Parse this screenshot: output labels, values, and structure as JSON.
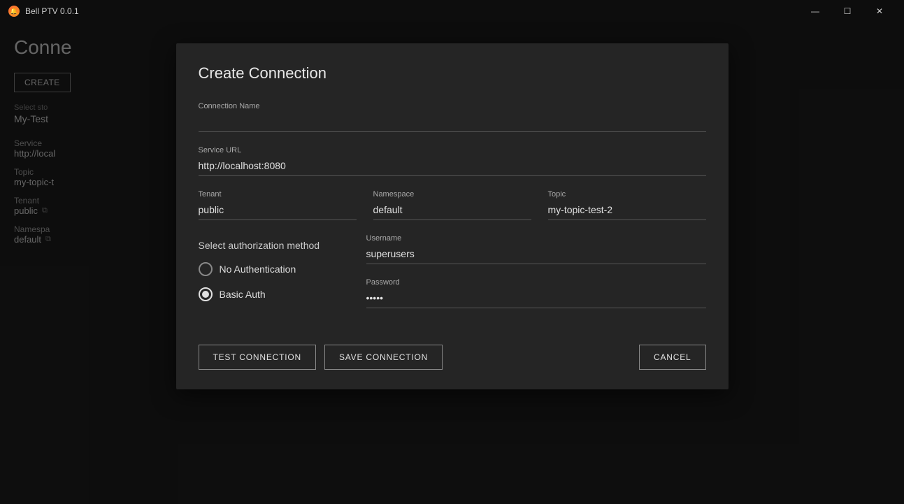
{
  "titlebar": {
    "title": "Bell PTV 0.0.1",
    "icon": "🔔",
    "minimize_label": "—",
    "maximize_label": "☐",
    "close_label": "✕"
  },
  "background": {
    "page_title": "Conne",
    "create_btn": "CREATE",
    "select_label": "Select sto",
    "select_value": "My-Test",
    "service_label": "Service",
    "service_value": "http://local",
    "topic_label": "Topic",
    "topic_value": "my-topic-t",
    "tenant_label": "Tenant",
    "tenant_value": "public",
    "namespace_label": "Namespa",
    "namespace_value": "default"
  },
  "modal": {
    "title": "Create Connection",
    "connection_name_label": "Connection Name",
    "connection_name_value": "",
    "connection_name_placeholder": "",
    "service_url_label": "Service URL",
    "service_url_value": "http://localhost:8080",
    "tenant_label": "Tenant",
    "tenant_value": "public",
    "namespace_label": "Namespace",
    "namespace_value": "default",
    "topic_label": "Topic",
    "topic_value": "my-topic-test-2",
    "auth_section_label": "Select authorization method",
    "auth_options": [
      {
        "label": "No Authentication",
        "selected": false
      },
      {
        "label": "Basic Auth",
        "selected": true
      }
    ],
    "username_label": "Username",
    "username_value": "superusers",
    "password_label": "Password",
    "password_dots": "•••••",
    "test_btn": "TEST CONNECTION",
    "save_btn": "SAVE CONNECTION",
    "cancel_btn": "CANCEL"
  }
}
